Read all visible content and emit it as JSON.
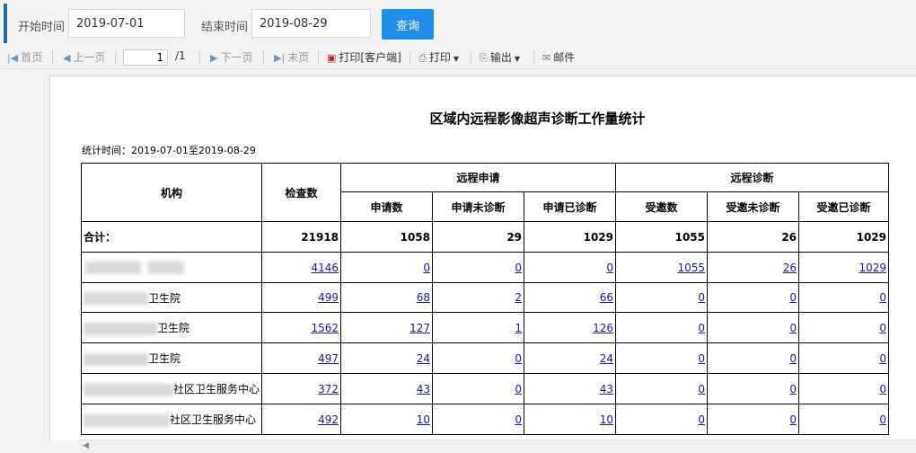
{
  "filter": {
    "start_label": "开始时间",
    "start_value": "2019-07-01",
    "end_label": "结束时间",
    "end_value": "2019-08-29",
    "query_label": "查询"
  },
  "toolbar": {
    "first": "首页",
    "prev": "上一页",
    "page_value": "1",
    "page_total": "/1",
    "next": "下一页",
    "last": "末页",
    "print_client": "打印[客户端]",
    "print": "打印",
    "export": "输出",
    "mail": "邮件"
  },
  "report": {
    "title": "区域内远程影像超声诊断工作量统计",
    "date_range": "统计时间：2019-07-01至2019-08-29",
    "headers": {
      "org": "机构",
      "exam": "检查数",
      "remote_request": "远程申请",
      "remote_diag": "远程诊断",
      "req_count": "申请数",
      "req_undiag": "申请未诊断",
      "req_diag": "申请已诊断",
      "inv_count": "受邀数",
      "inv_undiag": "受邀未诊断",
      "inv_diag": "受邀已诊断"
    },
    "total": {
      "label": "合计：",
      "values": [
        "21918",
        "1058",
        "29",
        "1029",
        "1055",
        "26",
        "1029"
      ]
    },
    "rows": [
      {
        "org": "",
        "values": [
          "4146",
          "0",
          "0",
          "0",
          "1055",
          "26",
          "1029"
        ]
      },
      {
        "org": "卫生院",
        "values": [
          "499",
          "68",
          "2",
          "66",
          "0",
          "0",
          "0"
        ]
      },
      {
        "org": "卫生院",
        "values": [
          "1562",
          "127",
          "1",
          "126",
          "0",
          "0",
          "0"
        ]
      },
      {
        "org": "卫生院",
        "values": [
          "497",
          "24",
          "0",
          "24",
          "0",
          "0",
          "0"
        ]
      },
      {
        "org": "社区卫生服务中心",
        "values": [
          "372",
          "43",
          "0",
          "43",
          "0",
          "0",
          "0"
        ]
      },
      {
        "org": "社区卫生服务中心",
        "values": [
          "492",
          "10",
          "0",
          "10",
          "0",
          "0",
          "0"
        ]
      }
    ]
  }
}
